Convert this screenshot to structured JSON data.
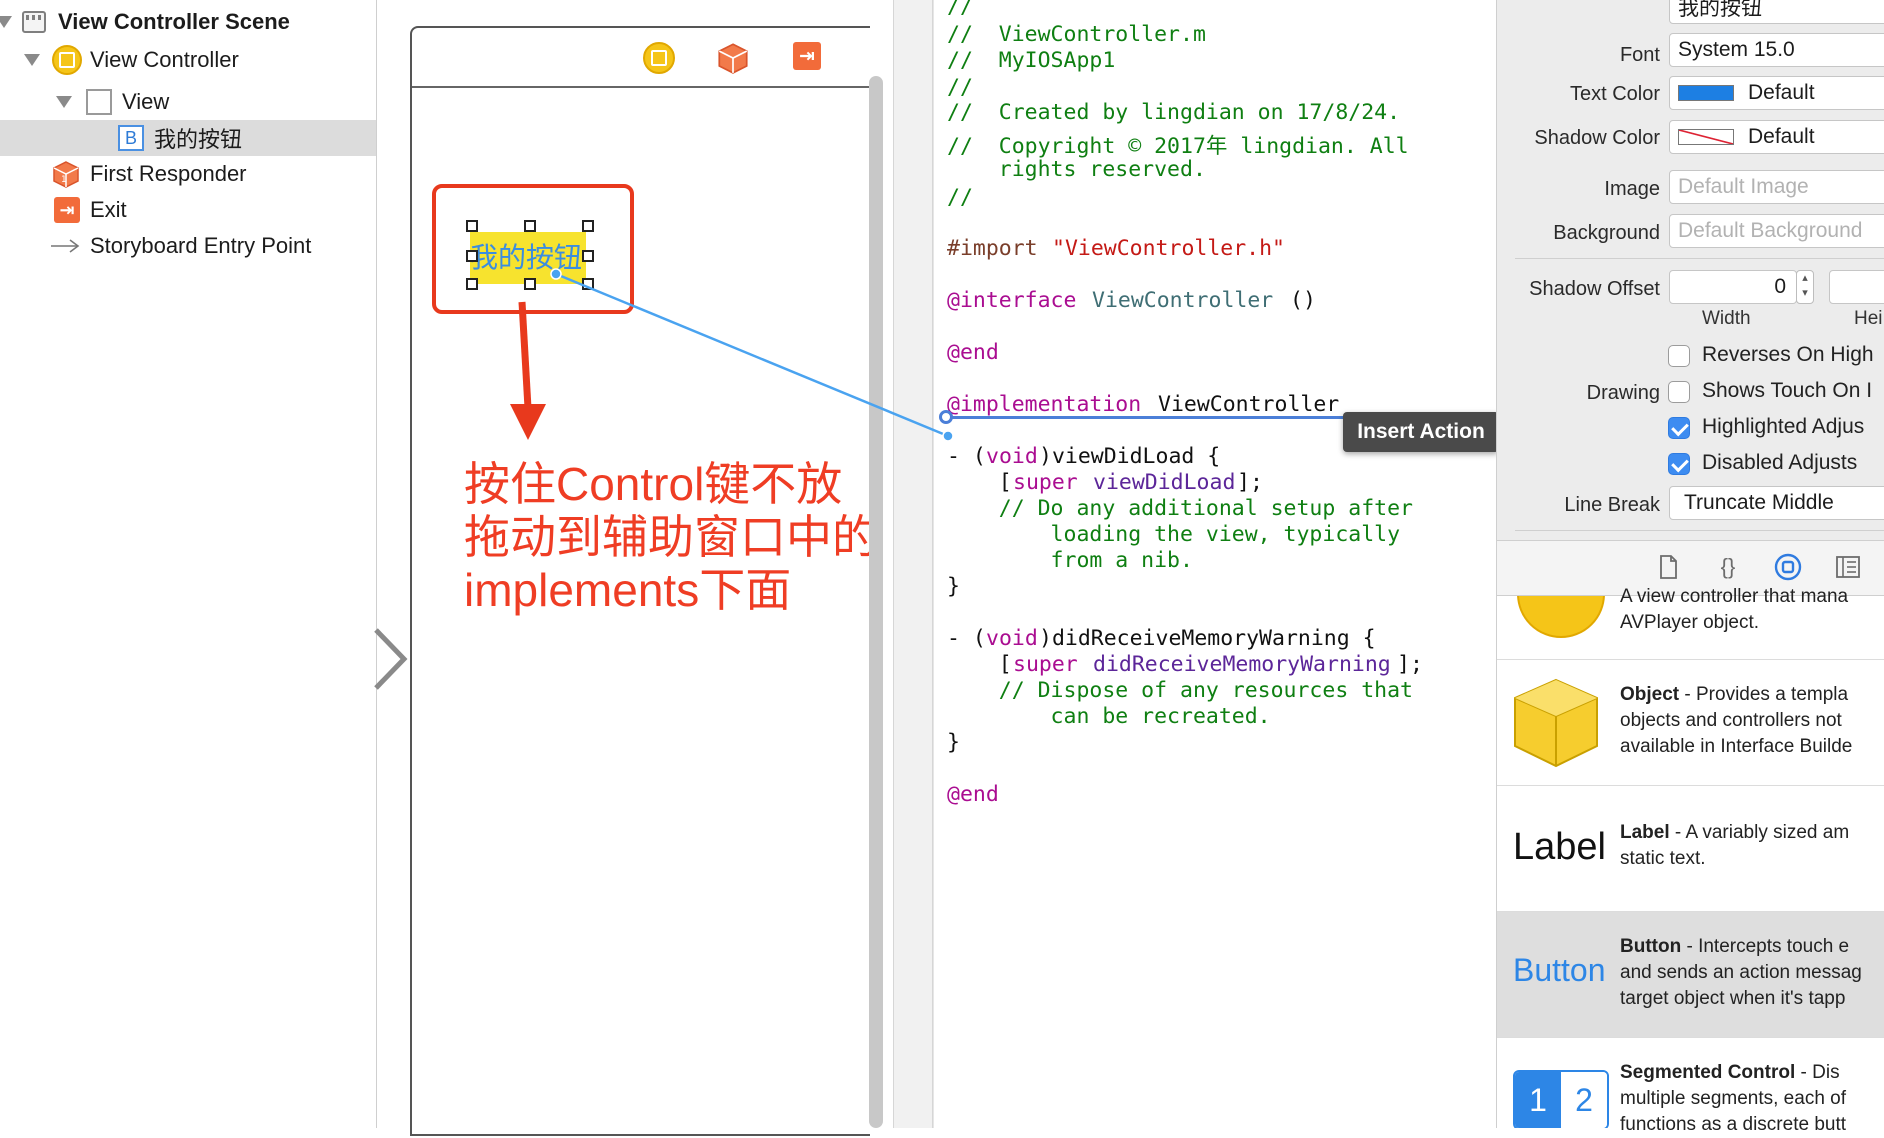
{
  "outline": {
    "items": [
      {
        "label": "View Controller Scene",
        "icon": "scene-icon"
      },
      {
        "label": "View Controller",
        "icon": "view-controller-icon"
      },
      {
        "label": "View",
        "icon": "view-icon"
      },
      {
        "label": "我的按钮",
        "icon": "button-icon",
        "icon_glyph": "B"
      },
      {
        "label": "First Responder",
        "icon": "first-responder-icon"
      },
      {
        "label": "Exit",
        "icon": "exit-icon"
      },
      {
        "label": "Storyboard Entry Point",
        "icon": "entry-arrow-icon"
      }
    ]
  },
  "canvas": {
    "button_title": "我的按钮",
    "callout_lines": [
      "按住Control键不放",
      "拖动到辅助窗口中的",
      "implements下面"
    ],
    "colors": {
      "annotation_red": "#e8391d",
      "button_yellow": "#f7e32e",
      "connection_blue": "#4aa3f0"
    }
  },
  "editor": {
    "lines": [
      {
        "text": "//"
      },
      {
        "text": "//  ViewController.m"
      },
      {
        "text": "//  MyIOSApp1"
      },
      {
        "text": "//"
      },
      {
        "text": "//  Created by lingdian on 17/8/24."
      },
      {
        "text": "//  Copyright © 2017年 lingdian. All"
      },
      {
        "text": "    rights reserved."
      },
      {
        "text": "//"
      },
      {
        "text": "#import"
      },
      {
        "text": "\"ViewController.h\""
      },
      {
        "text": "@interface"
      },
      {
        "text": "ViewController"
      },
      {
        "text": "()"
      },
      {
        "text": "@end"
      },
      {
        "text": "@implementation"
      },
      {
        "text": "ViewController"
      },
      {
        "text": "- ("
      },
      {
        "text": "void"
      },
      {
        "text": ")viewDidLoad {"
      },
      {
        "text": "    ["
      },
      {
        "text": "super"
      },
      {
        "text": "viewDidLoad"
      },
      {
        "text": "];"
      },
      {
        "text": "    // Do any additional setup after"
      },
      {
        "text": "        loading the view, typically"
      },
      {
        "text": "        from a nib."
      },
      {
        "text": "}"
      },
      {
        "text": "- ("
      },
      {
        "text": "void"
      },
      {
        "text": ")didReceiveMemoryWarning {"
      },
      {
        "text": "    ["
      },
      {
        "text": "super"
      },
      {
        "text": "didReceiveMemoryWarning"
      },
      {
        "text": "];"
      },
      {
        "text": "    // Dispose of any resources that"
      },
      {
        "text": "        can be recreated."
      },
      {
        "text": "}"
      },
      {
        "text": "@end"
      }
    ],
    "insert_action": "Insert Action"
  },
  "inspector": {
    "title_value": "我的按钮",
    "font_label": "Font",
    "font_value": "System 15.0",
    "text_color_label": "Text Color",
    "text_color_value": "Default",
    "shadow_color_label": "Shadow Color",
    "shadow_color_value": "Default",
    "image_label": "Image",
    "image_placeholder": "Default Image",
    "background_label": "Background",
    "background_placeholder": "Default Background",
    "shadow_offset_label": "Shadow Offset",
    "shadow_offset_width": "0",
    "width_caption": "Width",
    "height_caption": "Hei",
    "drawing_label": "Drawing",
    "checkboxes": [
      {
        "label": "Reverses On High",
        "checked": false
      },
      {
        "label": "Shows Touch On I",
        "checked": false
      },
      {
        "label": "Highlighted Adjus",
        "checked": true
      },
      {
        "label": "Disabled Adjusts",
        "checked": true
      }
    ],
    "line_break_label": "Line Break",
    "line_break_value": "Truncate Middle"
  },
  "library": {
    "tabs": [
      "file-icon",
      "braces-icon",
      "object-library-icon",
      "media-icon"
    ],
    "items": [
      {
        "name": "",
        "desc_lines": [
          "A view controller that mana",
          "AVPlayer object."
        ]
      },
      {
        "name": "Object",
        "desc_lines": [
          "- Provides a templa",
          "objects and controllers not",
          "available in Interface Builde"
        ]
      },
      {
        "name": "Label",
        "preview": "Label",
        "desc_lines": [
          "- A variably sized am",
          "static text."
        ]
      },
      {
        "name": "Button",
        "preview": "Button",
        "desc_lines": [
          "- Intercepts touch e",
          "and sends an action messag",
          "target object when it's tapp"
        ]
      },
      {
        "name": "Segmented Control",
        "preview_segments": [
          "1",
          "2"
        ],
        "desc_lines": [
          "- Dis",
          "multiple segments, each of",
          "functions as a discrete butt"
        ]
      }
    ]
  }
}
